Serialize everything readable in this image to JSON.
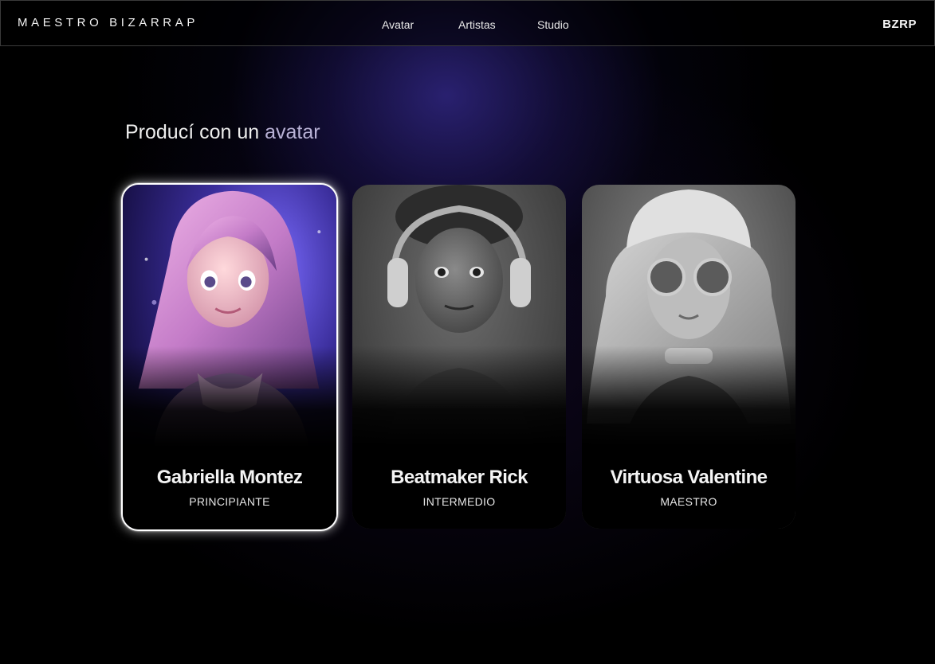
{
  "header": {
    "brand": "MAESTRO BIZARRAP",
    "nav": [
      "Avatar",
      "Artistas",
      "Studio"
    ],
    "logo": "BZRP"
  },
  "main": {
    "heading_part1": "Producí con un",
    "heading_part2": "avatar",
    "cards": [
      {
        "name": "Gabriella Montez",
        "level": "PRINCIPIANTE",
        "selected": true,
        "avatar": "girl-pink-hair-hoodie-portrait"
      },
      {
        "name": "Beatmaker Rick",
        "level": "INTERMEDIO",
        "selected": false,
        "avatar": "boy-headphones-portrait"
      },
      {
        "name": "Virtuosa Valentine",
        "level": "MAESTRO",
        "selected": false,
        "avatar": "girl-cap-sunglasses-portrait"
      }
    ]
  },
  "colors": {
    "background": "#000000",
    "glow": "#2a2280",
    "selected_border": "#ffffff"
  }
}
